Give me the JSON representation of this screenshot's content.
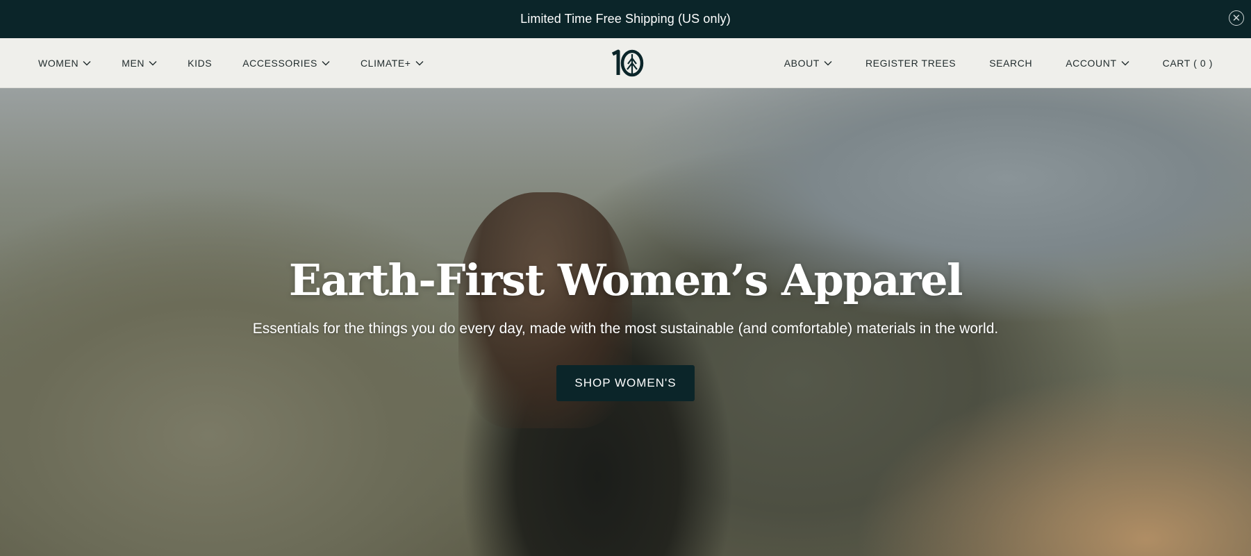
{
  "announcement": {
    "text": "Limited Time Free Shipping (US only)",
    "close_icon": "close-circle-icon"
  },
  "nav": {
    "left": [
      {
        "label": "WOMEN",
        "dropdown": true
      },
      {
        "label": "MEN",
        "dropdown": true
      },
      {
        "label": "KIDS",
        "dropdown": false
      },
      {
        "label": "ACCESSORIES",
        "dropdown": true
      },
      {
        "label": "CLIMATE+",
        "dropdown": true
      }
    ],
    "logo": {
      "text": "10",
      "icon": "tree-logo-icon"
    },
    "right": [
      {
        "label": "ABOUT",
        "dropdown": true
      },
      {
        "label": "REGISTER TREES",
        "dropdown": false
      },
      {
        "label": "SEARCH",
        "dropdown": false
      },
      {
        "label": "ACCOUNT",
        "dropdown": true
      },
      {
        "label": "CART ( 0 )",
        "dropdown": false
      }
    ]
  },
  "hero": {
    "title": "Earth-First Women’s Apparel",
    "subtitle": "Essentials for the things you do every day, made with the most sustainable (and comfortable) materials in the world.",
    "button_label": "SHOP WOMEN'S"
  },
  "colors": {
    "primary_dark": "#0b2529",
    "nav_bg": "#efefeb",
    "text": "#1f2a2b"
  }
}
